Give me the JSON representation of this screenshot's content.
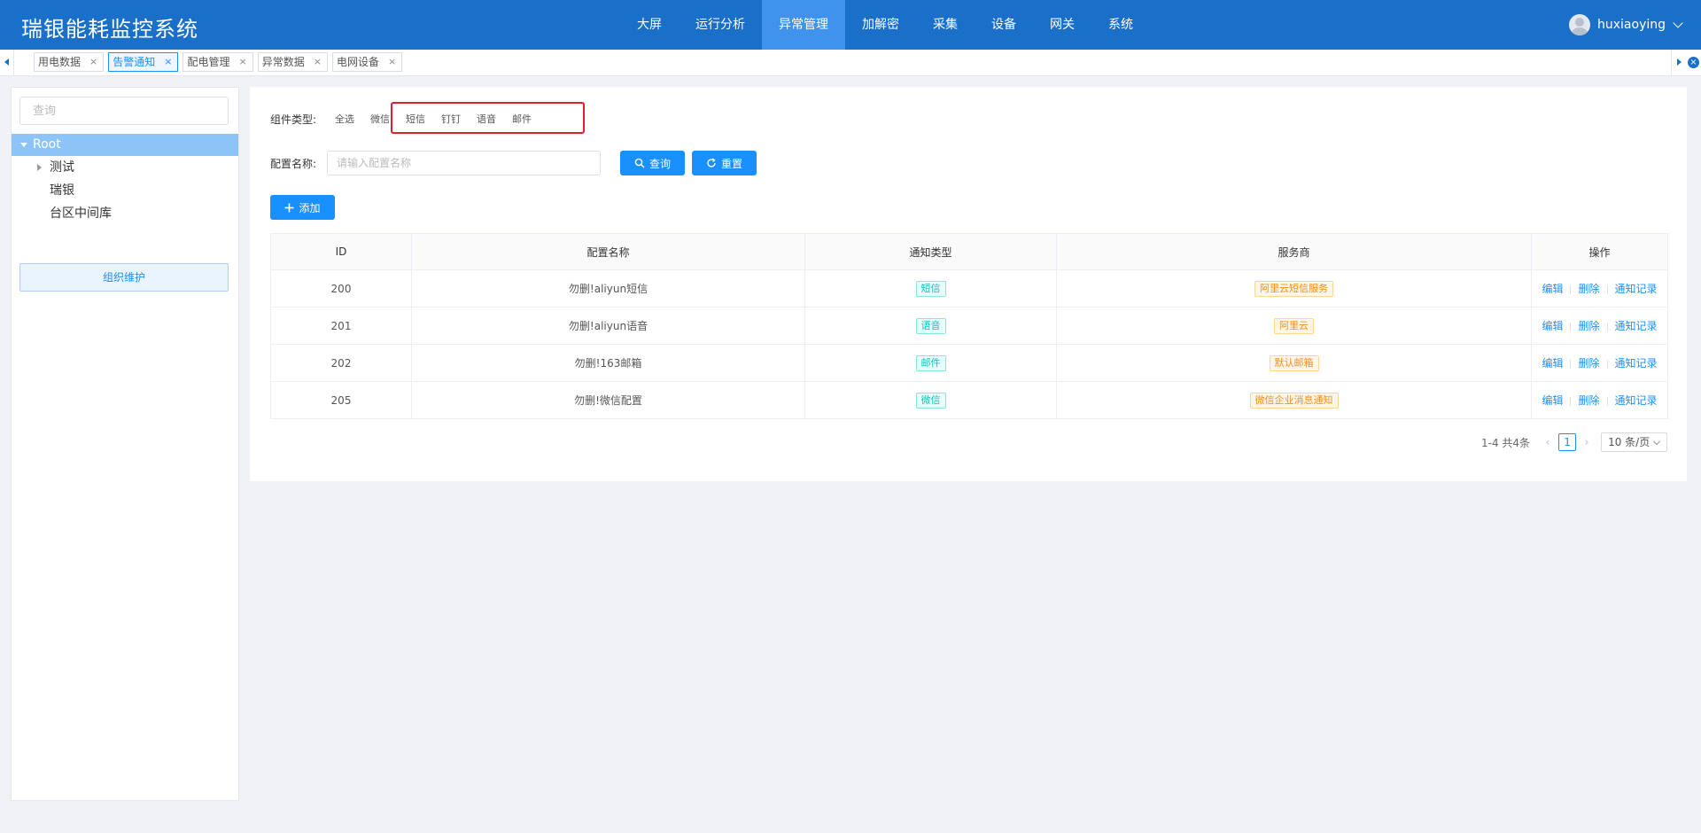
{
  "app": {
    "title": "瑞银能耗监控系统"
  },
  "nav": {
    "items": [
      "大屏",
      "运行分析",
      "异常管理",
      "加解密",
      "采集",
      "设备",
      "网关",
      "系统"
    ],
    "active_index": 2
  },
  "user": {
    "name": "huxiaoying"
  },
  "tabs": {
    "items": [
      "用电数据",
      "告警通知",
      "配电管理",
      "异常数据",
      "电网设备"
    ],
    "active_index": 1,
    "close_glyph": "×"
  },
  "sidebar": {
    "search_placeholder": "查询",
    "tree": {
      "root": "Root",
      "children": [
        "测试",
        "瑞银",
        "台区中间库"
      ]
    },
    "org_button": "组织维护"
  },
  "filters": {
    "type_label": "组件类型:",
    "type_options": [
      "全选",
      "微信",
      "短信",
      "钉钉",
      "语音",
      "邮件"
    ],
    "name_label": "配置名称:",
    "name_placeholder": "请输入配置名称",
    "query_button": "查询",
    "reset_button": "重置",
    "add_button": "添加"
  },
  "table": {
    "columns": [
      "ID",
      "配置名称",
      "通知类型",
      "服务商",
      "操作"
    ],
    "rows": [
      {
        "id": "200",
        "name": "勿删!aliyun短信",
        "type": "短信",
        "provider": "阿里云短信服务"
      },
      {
        "id": "201",
        "name": "勿删!aliyun语音",
        "type": "语音",
        "provider": "阿里云"
      },
      {
        "id": "202",
        "name": "勿删!163邮箱",
        "type": "邮件",
        "provider": "默认邮箱"
      },
      {
        "id": "205",
        "name": "勿删!微信配置",
        "type": "微信",
        "provider": "微信企业消息通知"
      }
    ],
    "actions": [
      "编辑",
      "删除",
      "通知记录"
    ]
  },
  "pagination": {
    "summary": "1-4 共4条",
    "current_page": "1",
    "page_size": "10 条/页"
  },
  "colors": {
    "header_bg": "#1a6fc9",
    "nav_active": "#3f93ec",
    "primary": "#1890ff",
    "highlight_box": "#e0202a",
    "type_tag": "#13c2c2",
    "provider_tag": "#fa8c16"
  }
}
